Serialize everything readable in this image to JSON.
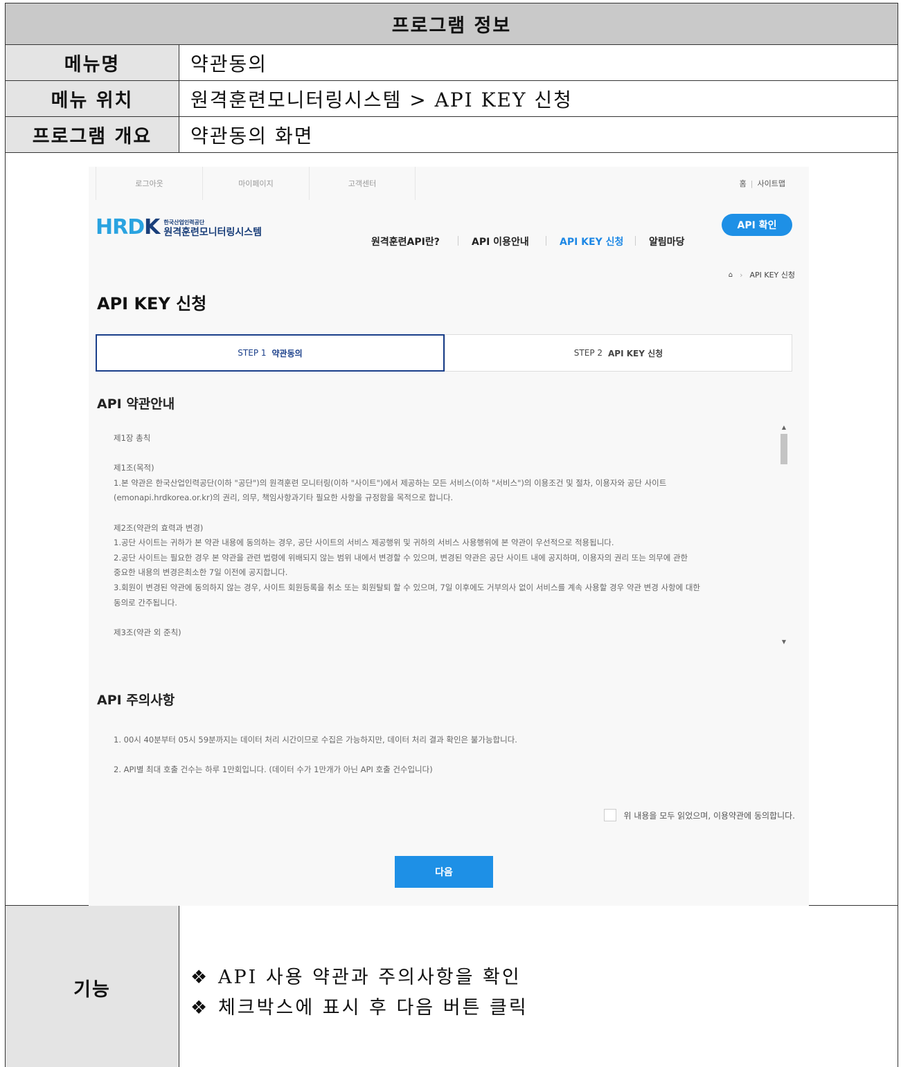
{
  "doc": {
    "header": "프로그램 정보",
    "rows": [
      {
        "label": "메뉴명",
        "value": "약관동의"
      },
      {
        "label": "메뉴 위치",
        "value": "원격훈련모니터링시스템 > API KEY 신청"
      },
      {
        "label": "프로그램 개요",
        "value": "약관동의 화면"
      }
    ],
    "function_label": "기능",
    "function_bullet": "❖",
    "functions": [
      "API 사용 약관과 주의사항을 확인",
      "체크박스에 표시 후 다음 버튼 클릭"
    ]
  },
  "screen": {
    "util_links": [
      "로그아웃",
      "마이페이지",
      "고객센터"
    ],
    "util_right": [
      "홈",
      "사이트맵"
    ],
    "logo": {
      "mark_a": "HR",
      "mark_b": "D",
      "mark_c": "K",
      "sub_top": "한국산업인력공단",
      "sub_main": "원격훈련모니터링시스템"
    },
    "nav": [
      "원격훈련API란?",
      "API 이용안내",
      "API KEY 신청",
      "알림마당"
    ],
    "api_check_button": "API 확인",
    "breadcrumb_current": "API KEY 신청",
    "page_title": "API KEY 신청",
    "steps": [
      {
        "num": "STEP 1",
        "label": "약관동의"
      },
      {
        "num": "STEP 2",
        "label": "API KEY 신청"
      }
    ],
    "terms_title": "API 약관안내",
    "terms_lines": [
      "제1장 총칙",
      "",
      "제1조(목적)",
      "1.본 약관은 한국산업인력공단(이하 \"공단\")의 원격훈련 모니터링(이하 \"사이트\")에서 제공하는 모든 서비스(이하 \"서비스\")의 이용조건 및 절차, 이용자와 공단 사이트",
      "(emonapi.hrdkorea.or.kr)의 권리, 의무, 책임사항과기타 필요한 사항을 규정함을 목적으로 합니다.",
      "",
      "제2조(약관의 효력과 변경)",
      "1.공단 사이트는 귀하가 본 약관 내용에 동의하는 경우, 공단 사이트의 서비스 제공행위 및 귀하의 서비스 사용행위에 본 약관이 우선적으로 적용됩니다.",
      "2.공단 사이트는 필요한 경우 본 약관을 관련 법령에 위배되지 않는 범위 내에서 변경할 수 있으며, 변경된 약관은 공단 사이트 내에 공지하며, 이용자의 권리 또는 의무에 관한",
      "중요한 내용의 변경은최소한 7일 이전에 공지합니다.",
      "3.회원이 변경된 약관에 동의하지 않는 경우, 사이트 회원등록을 취소 또는 회원탈퇴 할 수 있으며, 7일 이후에도 거부의사 없이 서비스를 계속 사용할 경우 약관 변경 사항에 대한",
      "동의로 간주됩니다.",
      "",
      "제3조(약관 외 준칙)"
    ],
    "notice_title": "API 주의사항",
    "notices": [
      "1. 00시 40분부터 05시 59분까지는 데이터 처리 시간이므로 수집은 가능하지만, 데이터 처리 결과 확인은 불가능합니다.",
      "2. API별 최대 호출 건수는 하루 1만회입니다. (데이터 수가 1만개가 아닌 API 호출 건수입니다)"
    ],
    "agree_text": "위 내용을 모두 읽었으며, 이용약관에 동의합니다.",
    "agree_checked": false,
    "next_button": "다음",
    "accent_color": "#1e90e6",
    "active_step_color": "#1a3f8a"
  }
}
